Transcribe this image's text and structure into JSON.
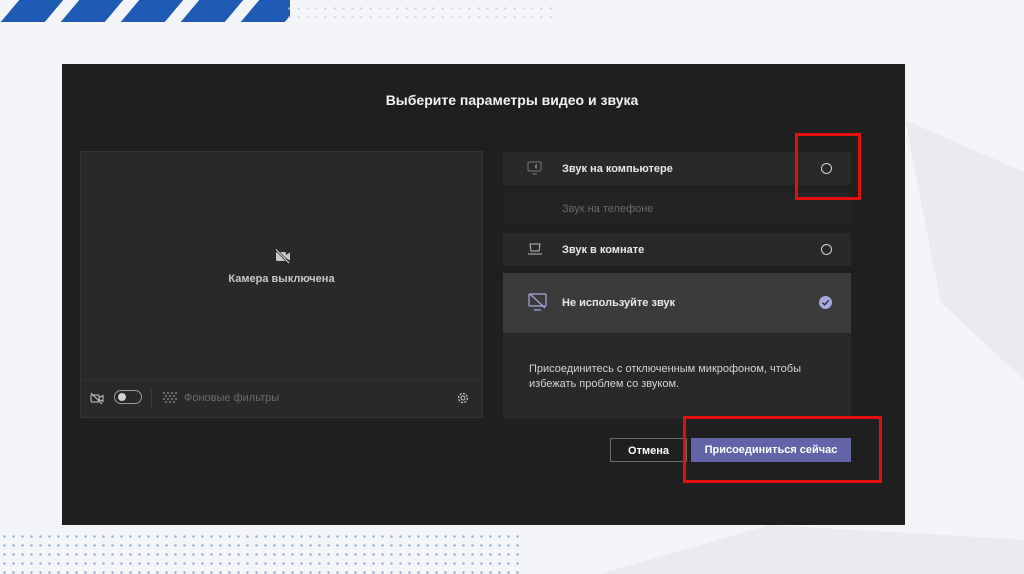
{
  "dialog": {
    "title": "Выберите параметры видео и звука"
  },
  "preview": {
    "camera_status": "Камера выключена",
    "background_filters_label": "Фоновые фильтры",
    "camera_toggle_on": false
  },
  "audio_options": [
    {
      "label": "Звук на компьютере",
      "selected": false,
      "enabled": true
    },
    {
      "label": "Звук на телефоне",
      "selected": false,
      "enabled": false
    },
    {
      "label": "Звук в комнате",
      "selected": false,
      "enabled": true
    },
    {
      "label": "Не используйте звук",
      "selected": true,
      "enabled": true
    }
  ],
  "info_text": "Присоединитесь с отключенным микрофоном, чтобы избежать проблем со звуком.",
  "buttons": {
    "cancel": "Отмена",
    "join": "Присоединиться сейчас"
  },
  "colors": {
    "accent": "#6264a7",
    "highlight": "#e01010",
    "slide_stripe": "#1f5bb5"
  }
}
